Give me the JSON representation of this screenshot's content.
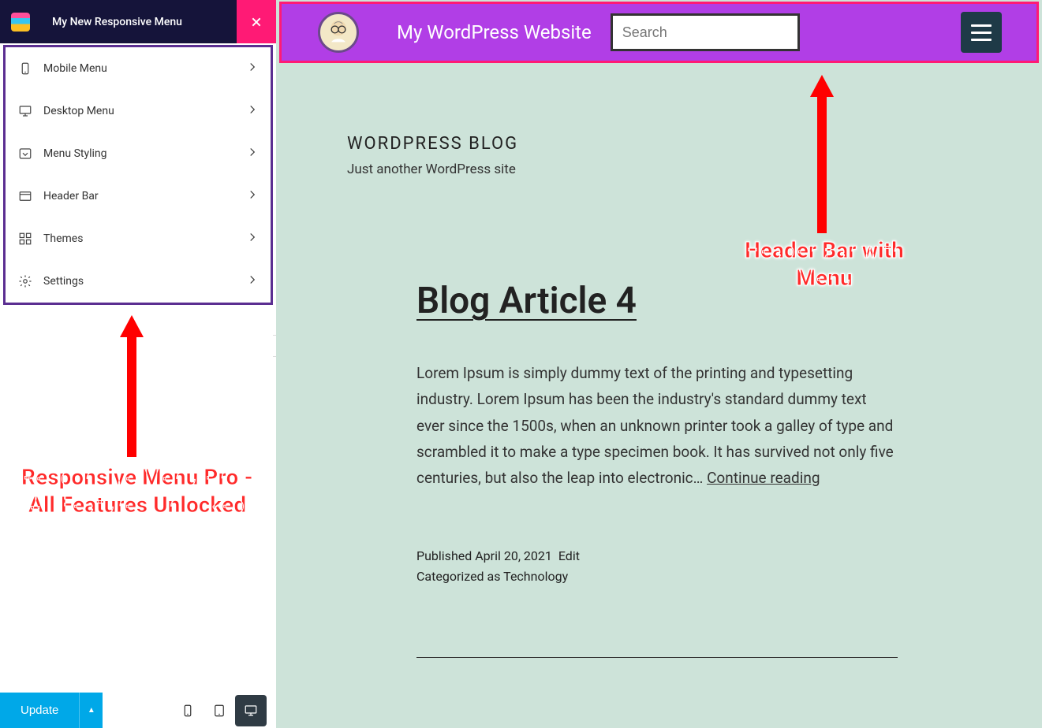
{
  "sidebar": {
    "title": "My New Responsive Menu",
    "items": [
      {
        "label": "Mobile Menu",
        "icon": "mobile-icon"
      },
      {
        "label": "Desktop Menu",
        "icon": "desktop-icon"
      },
      {
        "label": "Menu Styling",
        "icon": "dropdown-icon"
      },
      {
        "label": "Header Bar",
        "icon": "window-icon"
      },
      {
        "label": "Themes",
        "icon": "themes-icon"
      },
      {
        "label": "Settings",
        "icon": "gear-icon"
      }
    ]
  },
  "footer": {
    "update_label": "Update"
  },
  "annotations": {
    "left": "Responsive Menu Pro - All Features Unlocked",
    "right": "Header Bar with Menu"
  },
  "header_bar": {
    "site_title": "My WordPress Website",
    "search_placeholder": "Search"
  },
  "blog": {
    "site_heading": "WORDPRESS BLOG",
    "tagline": "Just another WordPress site",
    "article_title": "Blog Article 4",
    "body": "Lorem Ipsum is simply dummy text of the printing and typesetting industry. Lorem Ipsum has been the industry's standard dummy text ever since the 1500s, when an unknown printer took a galley of type and scrambled it to make a type specimen book. It has survived not only five centuries, but also the leap into electronic… ",
    "continue": "Continue reading",
    "published_label": "Published ",
    "published_date": "April 20, 2021",
    "edit_label": "Edit",
    "categorized_label": "Categorized as ",
    "category": "Technology"
  },
  "colors": {
    "sidebar_header": "#15143a",
    "close_btn": "#ff1a75",
    "menu_border": "#5b2e91",
    "update_btn": "#00a8e8",
    "preview_bg": "#cde3d9",
    "header_bar_bg": "#b13ee6",
    "header_bar_border": "#ff1a75",
    "hamburger_bg": "#1e3a47",
    "annotation": "#ff2a2a"
  }
}
